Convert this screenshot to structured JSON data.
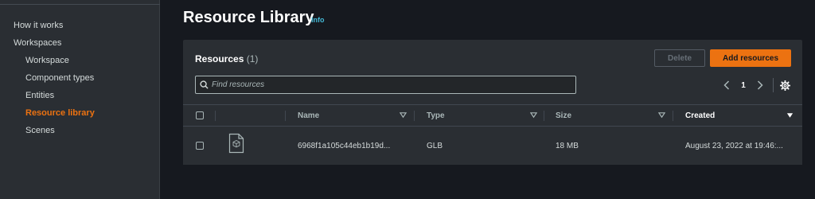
{
  "sidebar": {
    "items": [
      {
        "label": "How it works",
        "active": false
      },
      {
        "label": "Workspaces",
        "active": false
      },
      {
        "label": "Workspace",
        "active": false
      },
      {
        "label": "Component types",
        "active": false
      },
      {
        "label": "Entities",
        "active": false
      },
      {
        "label": "Resource library",
        "active": true
      },
      {
        "label": "Scenes",
        "active": false
      }
    ]
  },
  "header": {
    "title": "Resource Library",
    "info": "Info"
  },
  "panel": {
    "title": "Resources",
    "count": "(1)",
    "delete_label": "Delete",
    "add_label": "Add resources",
    "search_placeholder": "Find resources",
    "page_number": "1"
  },
  "table": {
    "columns": [
      "Name",
      "Type",
      "Size",
      "Created"
    ],
    "rows": [
      {
        "name": "6968f1a105c44eb1b19d...",
        "type": "GLB",
        "size": "18 MB",
        "created": "August 23, 2022 at 19:46:..."
      }
    ]
  },
  "colors": {
    "accent": "#ec7211",
    "link": "#44b9d6",
    "background": "#16191f",
    "panel": "#2a2e33"
  },
  "icons": [
    "search-icon",
    "chevron-left-icon",
    "chevron-right-icon",
    "gear-icon",
    "sort-down-icon",
    "file-3d-icon"
  ]
}
